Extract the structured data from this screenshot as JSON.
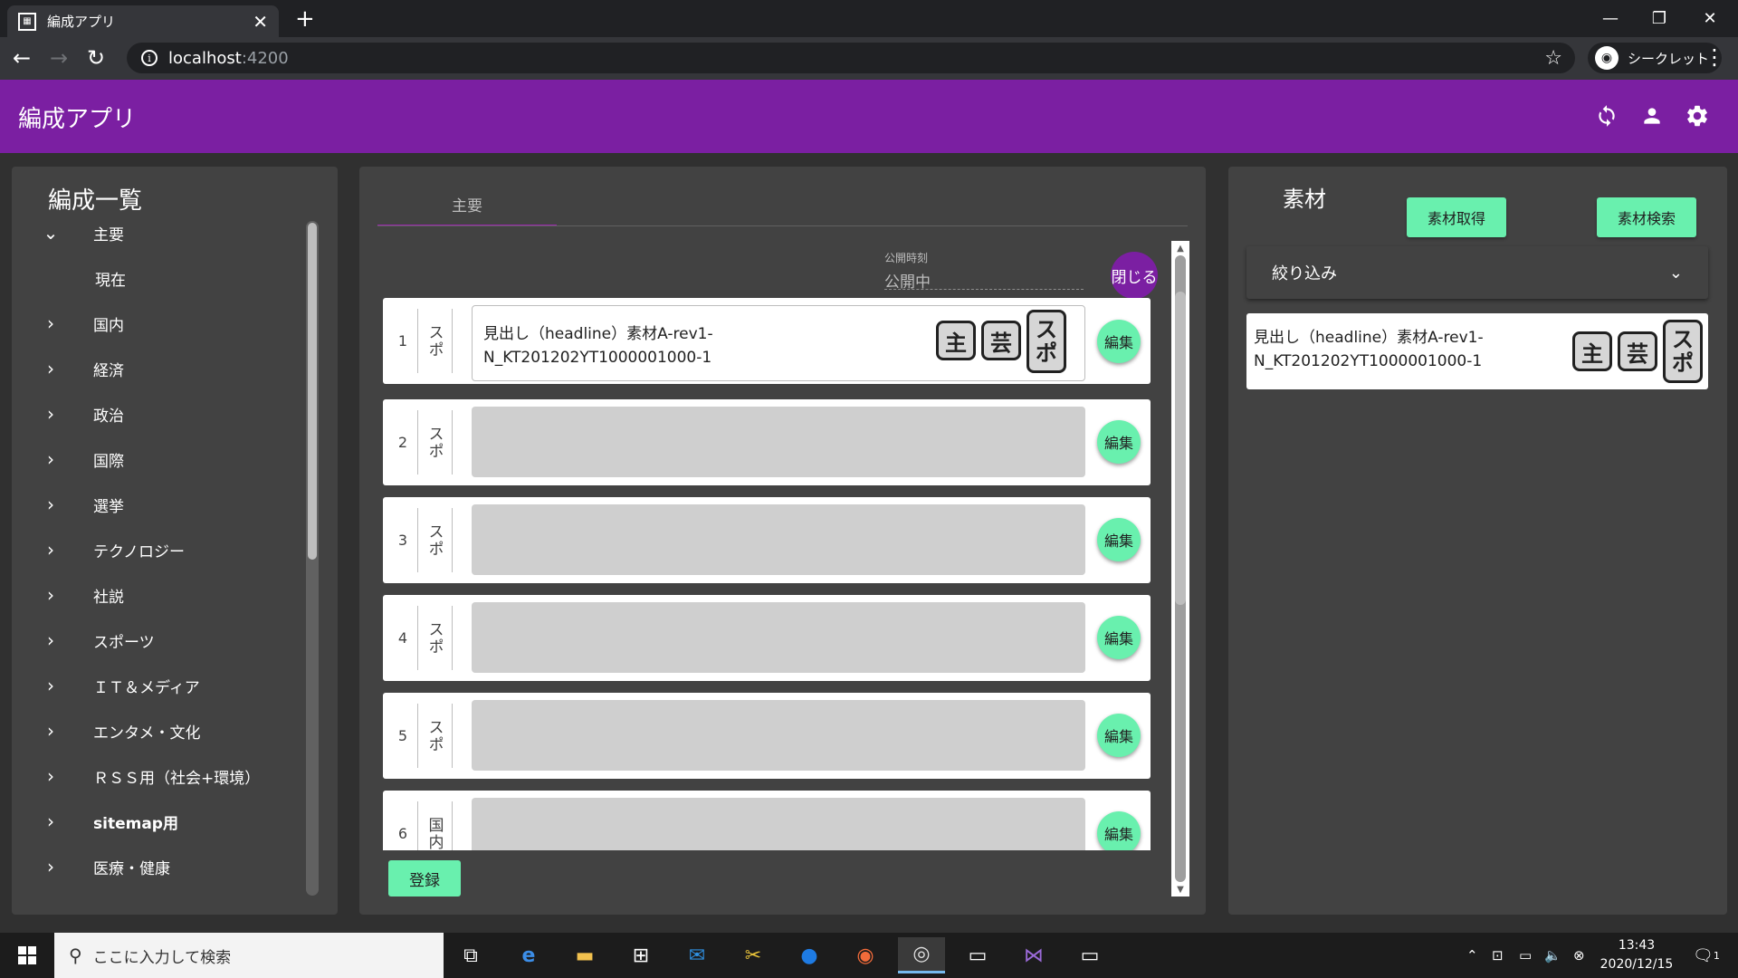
{
  "browser": {
    "tab_title": "編成アプリ",
    "tab_close": "✕",
    "new_tab": "+",
    "url_host": "localhost",
    "url_port": ":4200",
    "incognito_label": "シークレット",
    "controls": {
      "minimize": "—",
      "restore": "❐",
      "close": "✕"
    }
  },
  "app": {
    "title": "編成アプリ",
    "accent_color": "#7b1fa2",
    "button_color": "#69f0ae"
  },
  "left_panel": {
    "title": "編成一覧",
    "items": [
      {
        "label": "主要",
        "expanded": true,
        "chevron": "⌄"
      },
      {
        "label": "現在",
        "sub": true
      },
      {
        "label": "国内",
        "chevron": "›"
      },
      {
        "label": "経済",
        "chevron": "›"
      },
      {
        "label": "政治",
        "chevron": "›"
      },
      {
        "label": "国際",
        "chevron": "›"
      },
      {
        "label": "選挙",
        "chevron": "›"
      },
      {
        "label": "テクノロジー",
        "chevron": "›"
      },
      {
        "label": "社説",
        "chevron": "›"
      },
      {
        "label": "スポーツ",
        "chevron": "›"
      },
      {
        "label": "ＩＴ＆メディア",
        "chevron": "›"
      },
      {
        "label": "エンタメ・文化",
        "chevron": "›"
      },
      {
        "label": "ＲＳＳ用（社会+環境）",
        "chevron": "›"
      },
      {
        "label": "sitemap用",
        "chevron": "›"
      },
      {
        "label": "医療・健康",
        "chevron": "›"
      }
    ]
  },
  "center_panel": {
    "tab_label": "主要",
    "publish_label": "公開時刻",
    "publish_value": "公開中",
    "close_label": "閉じる",
    "edit_label": "編集",
    "register_label": "登録",
    "rows": [
      {
        "num": "1",
        "category": "スポ",
        "text": "見出し（headline）素材A-rev1-N_KT201202YT1000001000-1",
        "tags": [
          "主",
          "芸",
          "スポ"
        ]
      },
      {
        "num": "2",
        "category": "スポ",
        "text": ""
      },
      {
        "num": "3",
        "category": "スポ",
        "text": ""
      },
      {
        "num": "4",
        "category": "スポ",
        "text": ""
      },
      {
        "num": "5",
        "category": "スポ",
        "text": ""
      },
      {
        "num": "6",
        "category": "国内",
        "text": ""
      }
    ]
  },
  "right_panel": {
    "title": "素材",
    "fetch_label": "素材取得",
    "search_label": "素材検索",
    "filter_label": "絞り込み",
    "card_text": "見出し（headline）素材A-rev1-N_KT201202YT1000001000-1",
    "card_tags": [
      "主",
      "芸",
      "スポ"
    ]
  },
  "taskbar": {
    "search_placeholder": "ここに入力して検索",
    "time": "13:43",
    "date": "2020/12/15",
    "notifications": "1"
  }
}
